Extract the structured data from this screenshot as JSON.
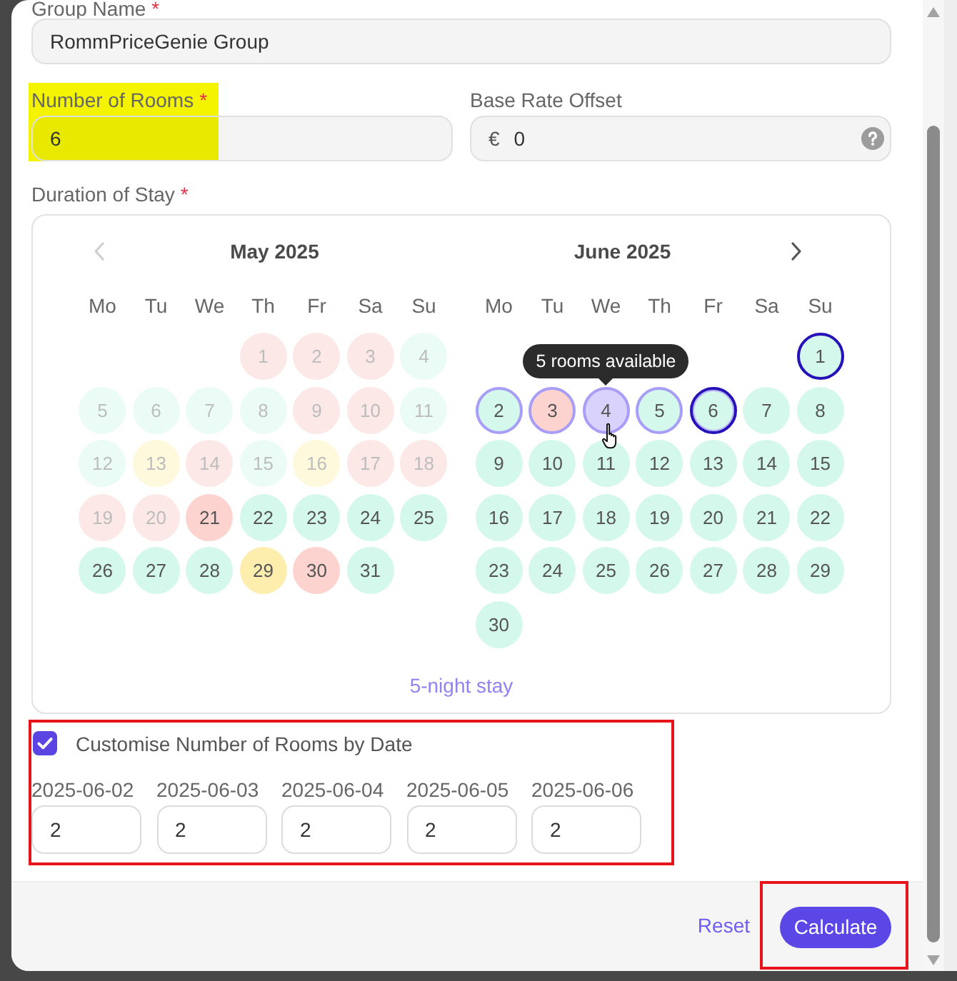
{
  "form": {
    "group_name": {
      "label": "Group Name",
      "marker": "*",
      "value": "RommPriceGenie Group"
    },
    "rooms": {
      "label": "Number of Rooms",
      "marker": "*",
      "value": "6",
      "highlight": true
    },
    "base_rate_offset": {
      "label": "Base Rate Offset",
      "prefix": "€",
      "value": "0"
    },
    "duration": {
      "label": "Duration of Stay",
      "marker": "*"
    }
  },
  "calendar": {
    "months": [
      {
        "title": "May 2025",
        "nav": {
          "kind": "previous",
          "disabled": true
        },
        "weekdays": [
          "Mo",
          "Tu",
          "We",
          "Th",
          "Fr",
          "Sa",
          "Su"
        ],
        "weeks": [
          [
            {
              "day": "1",
              "color": "#fde8e8",
              "disabled": true,
              "selected": false,
              "outlined": false,
              "hovered": false
            },
            {
              "day": "2",
              "color": "#fde8e8",
              "disabled": true,
              "selected": false,
              "outlined": false,
              "hovered": false
            },
            {
              "day": "3",
              "color": "#fde8e8",
              "disabled": true,
              "selected": false,
              "outlined": false,
              "hovered": false
            },
            {
              "day": "4",
              "color": "#ebfcf7",
              "disabled": true,
              "selected": false,
              "outlined": false,
              "hovered": false
            }
          ],
          [
            {
              "day": "5",
              "color": "#ebfcf7",
              "disabled": true,
              "selected": false,
              "outlined": false,
              "hovered": false
            },
            {
              "day": "6",
              "color": "#ebfcf7",
              "disabled": true,
              "selected": false,
              "outlined": false,
              "hovered": false
            },
            {
              "day": "7",
              "color": "#ebfcf7",
              "disabled": true,
              "selected": false,
              "outlined": false,
              "hovered": false
            },
            {
              "day": "8",
              "color": "#ebfcf7",
              "disabled": true,
              "selected": false,
              "outlined": false,
              "hovered": false
            },
            {
              "day": "9",
              "color": "#fde8e8",
              "disabled": true,
              "selected": false,
              "outlined": false,
              "hovered": false
            },
            {
              "day": "10",
              "color": "#fde8e8",
              "disabled": true,
              "selected": false,
              "outlined": false,
              "hovered": false
            },
            {
              "day": "11",
              "color": "#ebfcf7",
              "disabled": true,
              "selected": false,
              "outlined": false,
              "hovered": false
            }
          ],
          [
            {
              "day": "12",
              "color": "#ebfcf7",
              "disabled": true,
              "selected": false,
              "outlined": false,
              "hovered": false
            },
            {
              "day": "13",
              "color": "#fef8dc",
              "disabled": true,
              "selected": false,
              "outlined": false,
              "hovered": false
            },
            {
              "day": "14",
              "color": "#fde8e8",
              "disabled": true,
              "selected": false,
              "outlined": false,
              "hovered": false
            },
            {
              "day": "15",
              "color": "#ebfcf7",
              "disabled": true,
              "selected": false,
              "outlined": false,
              "hovered": false
            },
            {
              "day": "16",
              "color": "#fef8dc",
              "disabled": true,
              "selected": false,
              "outlined": false,
              "hovered": false
            },
            {
              "day": "17",
              "color": "#fde8e8",
              "disabled": true,
              "selected": false,
              "outlined": false,
              "hovered": false
            },
            {
              "day": "18",
              "color": "#fde8e8",
              "disabled": true,
              "selected": false,
              "outlined": false,
              "hovered": false
            }
          ],
          [
            {
              "day": "19",
              "color": "#fde8e8",
              "disabled": true,
              "selected": false,
              "outlined": false,
              "hovered": false
            },
            {
              "day": "20",
              "color": "#fde8e8",
              "disabled": true,
              "selected": false,
              "outlined": false,
              "hovered": false
            },
            {
              "day": "21",
              "color": "#fdd3cf",
              "disabled": false,
              "selected": false,
              "outlined": false,
              "hovered": false
            },
            {
              "day": "22",
              "color": "#d4f8ec",
              "disabled": false,
              "selected": false,
              "outlined": false,
              "hovered": false
            },
            {
              "day": "23",
              "color": "#d4f8ec",
              "disabled": false,
              "selected": false,
              "outlined": false,
              "hovered": false
            },
            {
              "day": "24",
              "color": "#d4f8ec",
              "disabled": false,
              "selected": false,
              "outlined": false,
              "hovered": false
            },
            {
              "day": "25",
              "color": "#d4f8ec",
              "disabled": false,
              "selected": false,
              "outlined": false,
              "hovered": false
            }
          ],
          [
            {
              "day": "26",
              "color": "#d4f8ec",
              "disabled": false,
              "selected": false,
              "outlined": false,
              "hovered": false
            },
            {
              "day": "27",
              "color": "#d4f8ec",
              "disabled": false,
              "selected": false,
              "outlined": false,
              "hovered": false
            },
            {
              "day": "28",
              "color": "#d4f8ec",
              "disabled": false,
              "selected": false,
              "outlined": false,
              "hovered": false
            },
            {
              "day": "29",
              "color": "#fdeeae",
              "disabled": false,
              "selected": false,
              "outlined": false,
              "hovered": false
            },
            {
              "day": "30",
              "color": "#fdd3cf",
              "disabled": false,
              "selected": false,
              "outlined": false,
              "hovered": false
            },
            {
              "day": "31",
              "color": "#d4f8ec",
              "disabled": false,
              "selected": false,
              "outlined": false,
              "hovered": false
            }
          ]
        ]
      },
      {
        "title": "June 2025",
        "nav": {
          "kind": "next",
          "disabled": false
        },
        "weekdays": [
          "Mo",
          "Tu",
          "We",
          "Th",
          "Fr",
          "Sa",
          "Su"
        ],
        "weeks": [
          [
            {
              "day": "1",
              "color": "#d4f8ec",
              "disabled": false,
              "selected": false,
              "outlined": true,
              "hovered": false
            }
          ],
          [
            {
              "day": "2",
              "color": "#d4f8ec",
              "disabled": false,
              "selected": true,
              "outlined": false,
              "hovered": false
            },
            {
              "day": "3",
              "color": "#fdd3cf",
              "disabled": false,
              "selected": true,
              "outlined": false,
              "hovered": false
            },
            {
              "day": "4",
              "color": "#d8d2fd",
              "disabled": false,
              "selected": true,
              "outlined": false,
              "hovered": true,
              "tooltip": "5 rooms available"
            },
            {
              "day": "5",
              "color": "#d4f8ec",
              "disabled": false,
              "selected": true,
              "outlined": false,
              "hovered": false
            },
            {
              "day": "6",
              "color": "#d4f8ec",
              "disabled": false,
              "selected": true,
              "outlined": true,
              "hovered": false
            },
            {
              "day": "7",
              "color": "#d4f8ec",
              "disabled": false,
              "selected": false,
              "outlined": false,
              "hovered": false
            },
            {
              "day": "8",
              "color": "#d4f8ec",
              "disabled": false,
              "selected": false,
              "outlined": false,
              "hovered": false
            }
          ],
          [
            {
              "day": "9",
              "color": "#d4f8ec",
              "disabled": false,
              "selected": false,
              "outlined": false,
              "hovered": false
            },
            {
              "day": "10",
              "color": "#d4f8ec",
              "disabled": false,
              "selected": false,
              "outlined": false,
              "hovered": false
            },
            {
              "day": "11",
              "color": "#d4f8ec",
              "disabled": false,
              "selected": false,
              "outlined": false,
              "hovered": false
            },
            {
              "day": "12",
              "color": "#d4f8ec",
              "disabled": false,
              "selected": false,
              "outlined": false,
              "hovered": false
            },
            {
              "day": "13",
              "color": "#d4f8ec",
              "disabled": false,
              "selected": false,
              "outlined": false,
              "hovered": false
            },
            {
              "day": "14",
              "color": "#d4f8ec",
              "disabled": false,
              "selected": false,
              "outlined": false,
              "hovered": false
            },
            {
              "day": "15",
              "color": "#d4f8ec",
              "disabled": false,
              "selected": false,
              "outlined": false,
              "hovered": false
            }
          ],
          [
            {
              "day": "16",
              "color": "#d4f8ec",
              "disabled": false,
              "selected": false,
              "outlined": false,
              "hovered": false
            },
            {
              "day": "17",
              "color": "#d4f8ec",
              "disabled": false,
              "selected": false,
              "outlined": false,
              "hovered": false
            },
            {
              "day": "18",
              "color": "#d4f8ec",
              "disabled": false,
              "selected": false,
              "outlined": false,
              "hovered": false
            },
            {
              "day": "19",
              "color": "#d4f8ec",
              "disabled": false,
              "selected": false,
              "outlined": false,
              "hovered": false
            },
            {
              "day": "20",
              "color": "#d4f8ec",
              "disabled": false,
              "selected": false,
              "outlined": false,
              "hovered": false
            },
            {
              "day": "21",
              "color": "#d4f8ec",
              "disabled": false,
              "selected": false,
              "outlined": false,
              "hovered": false
            },
            {
              "day": "22",
              "color": "#d4f8ec",
              "disabled": false,
              "selected": false,
              "outlined": false,
              "hovered": false
            }
          ],
          [
            {
              "day": "23",
              "color": "#d4f8ec",
              "disabled": false,
              "selected": false,
              "outlined": false,
              "hovered": false
            },
            {
              "day": "24",
              "color": "#d4f8ec",
              "disabled": false,
              "selected": false,
              "outlined": false,
              "hovered": false
            },
            {
              "day": "25",
              "color": "#d4f8ec",
              "disabled": false,
              "selected": false,
              "outlined": false,
              "hovered": false
            },
            {
              "day": "26",
              "color": "#d4f8ec",
              "disabled": false,
              "selected": false,
              "outlined": false,
              "hovered": false
            },
            {
              "day": "27",
              "color": "#d4f8ec",
              "disabled": false,
              "selected": false,
              "outlined": false,
              "hovered": false
            },
            {
              "day": "28",
              "color": "#d4f8ec",
              "disabled": false,
              "selected": false,
              "outlined": false,
              "hovered": false
            },
            {
              "day": "29",
              "color": "#d4f8ec",
              "disabled": false,
              "selected": false,
              "outlined": false,
              "hovered": false
            }
          ],
          [
            {
              "day": "30",
              "color": "#d4f8ec",
              "disabled": false,
              "selected": false,
              "outlined": false,
              "hovered": false
            }
          ]
        ]
      }
    ],
    "stay_length": "5-night stay"
  },
  "customise": {
    "label": "Customise Number of Rooms by Date",
    "checked": true,
    "boxed": true,
    "dates": [
      {
        "label": "2025-06-02",
        "value": "2"
      },
      {
        "label": "2025-06-03",
        "value": "2"
      },
      {
        "label": "2025-06-04",
        "value": "2"
      },
      {
        "label": "2025-06-05",
        "value": "2"
      },
      {
        "label": "2025-06-06",
        "value": "2"
      }
    ]
  },
  "actions": [
    {
      "kind": "link",
      "label": "Reset"
    },
    {
      "kind": "button",
      "label": "Calculate",
      "boxed": true
    }
  ]
}
